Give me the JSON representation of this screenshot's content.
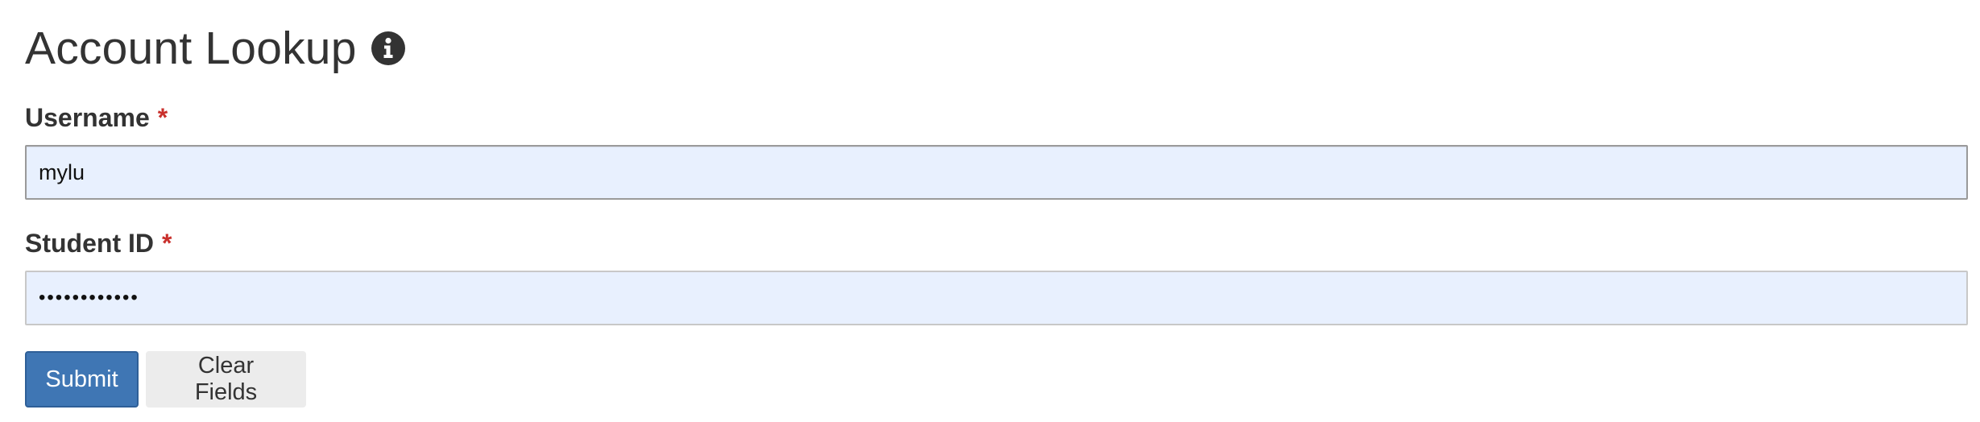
{
  "page": {
    "title": "Account Lookup",
    "info_icon": "info-circle-icon"
  },
  "form": {
    "username": {
      "label": "Username",
      "required_mark": "*",
      "value": "mylu"
    },
    "student_id": {
      "label": "Student ID",
      "required_mark": "*",
      "value": "••••••••••••",
      "type": "password"
    },
    "buttons": {
      "submit_label": "Submit",
      "clear_label": "Clear Fields"
    }
  },
  "colors": {
    "primary_button": "#3f76b4",
    "required": "#c9302c",
    "autofill_background": "#e8f0fe",
    "secondary_button": "#ececec"
  }
}
